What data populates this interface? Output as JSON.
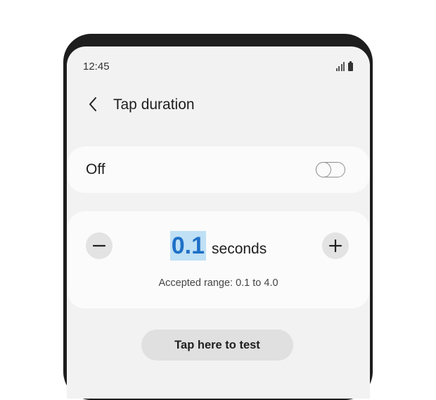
{
  "status_bar": {
    "time": "12:45",
    "icons": [
      "signal-icon",
      "battery-icon"
    ]
  },
  "header": {
    "back_icon": "chevron-left-icon",
    "title": "Tap duration"
  },
  "toggle": {
    "label": "Off",
    "checked": false
  },
  "duration": {
    "value": "0.1",
    "unit": "seconds",
    "range_text": "Accepted range: 0.1 to 4.0",
    "minus_icon": "minus-icon",
    "plus_icon": "plus-icon"
  },
  "test_button": {
    "label": "Tap here to test"
  },
  "colors": {
    "accent": "#1f70c7",
    "selection": "#bfe0f5",
    "background": "#f2f2f2",
    "card": "#fbfbfb"
  }
}
